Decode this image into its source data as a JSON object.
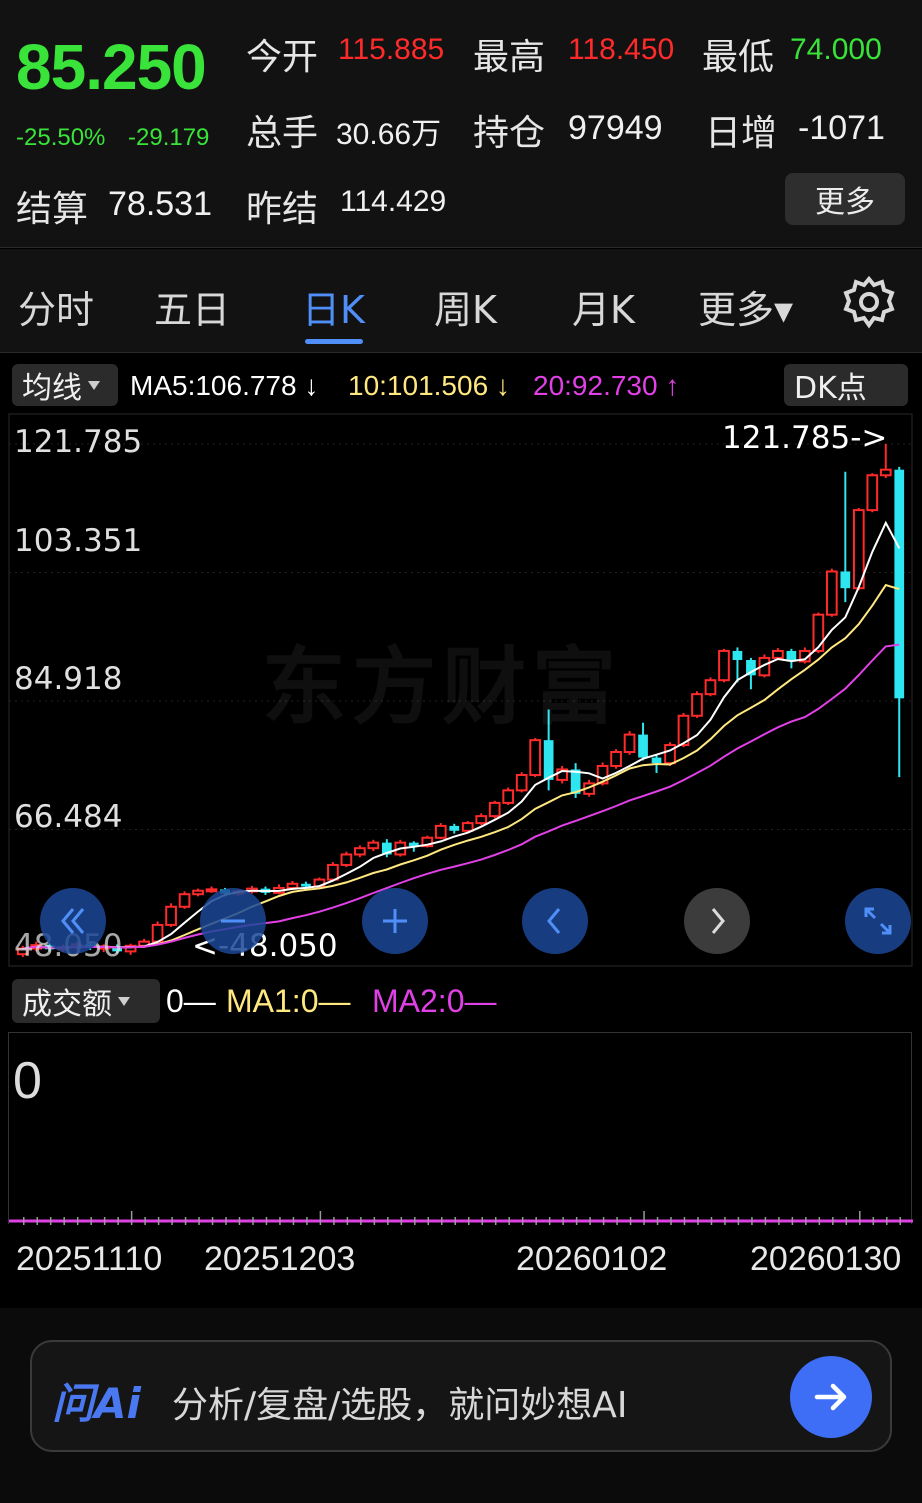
{
  "quote": {
    "price": "85.250",
    "change_pct": "-25.50%",
    "change_abs": "-29.179",
    "open_label": "今开",
    "open": "115.885",
    "high_label": "最高",
    "high": "118.450",
    "low_label": "最低",
    "low": "74.000",
    "volume_label": "总手",
    "volume": "30.66万",
    "oi_label": "持仓",
    "oi": "97949",
    "daily_label": "日增",
    "daily": "-1071",
    "settle_label": "结算",
    "settle": "78.531",
    "prev_settle_label": "昨结",
    "prev_settle": "114.429",
    "more_label": "更多"
  },
  "tabs": [
    {
      "label": "分时"
    },
    {
      "label": "五日"
    },
    {
      "label": "日K",
      "active": true
    },
    {
      "label": "周K"
    },
    {
      "label": "月K"
    },
    {
      "label": "更多▾"
    }
  ],
  "settings_icon": "gear-icon",
  "ma_row": {
    "selector_label": "均线",
    "ma5": "MA5:106.778 ↓",
    "ma10": "10:101.506 ↓",
    "ma20": "20:92.730 ↑",
    "dk_label": "DK点"
  },
  "colors": {
    "up": "#ff2a2a",
    "down": "#2ee6f0",
    "ma5": "#ffffff",
    "ma10": "#ffe880",
    "ma20": "#e040e6",
    "accent": "#4f8ff7",
    "green": "#39e33a"
  },
  "chart_data": {
    "type": "candlestick",
    "y_ticks": [
      "121.785",
      "103.351",
      "84.918",
      "66.484",
      "48.050"
    ],
    "ylim": [
      48.05,
      121.785
    ],
    "high_annotation": "121.785->",
    "low_annotation": "<-48.050",
    "watermark": "东方财富",
    "x_dates": [
      "20251110",
      "20251203",
      "20260102",
      "20260130"
    ],
    "candles": [
      [
        48.6,
        49.4,
        48.2,
        49.8
      ],
      [
        49.4,
        49.9,
        49.0,
        50.4
      ],
      [
        49.9,
        49.3,
        49.0,
        50.2
      ],
      [
        49.3,
        49.6,
        48.9,
        50.0
      ],
      [
        49.6,
        50.0,
        49.2,
        50.3
      ],
      [
        50.0,
        49.6,
        49.2,
        50.3
      ],
      [
        49.6,
        49.7,
        48.9,
        50.0
      ],
      [
        49.7,
        49.0,
        48.7,
        50.0
      ],
      [
        49.0,
        49.8,
        48.5,
        50.1
      ],
      [
        49.8,
        50.4,
        49.5,
        50.8
      ],
      [
        50.4,
        52.8,
        50.1,
        53.3
      ],
      [
        52.8,
        55.4,
        52.5,
        55.9
      ],
      [
        55.4,
        57.2,
        55.1,
        57.6
      ],
      [
        57.2,
        57.7,
        56.9,
        58.0
      ],
      [
        57.7,
        57.9,
        57.4,
        58.3
      ],
      [
        57.9,
        57.3,
        56.9,
        58.1
      ],
      [
        57.3,
        57.6,
        57.0,
        57.9
      ],
      [
        57.6,
        58.0,
        57.3,
        58.4
      ],
      [
        58.0,
        57.4,
        57.1,
        58.3
      ],
      [
        57.4,
        58.1,
        57.2,
        58.6
      ],
      [
        58.1,
        58.7,
        57.8,
        59.1
      ],
      [
        58.7,
        58.3,
        57.9,
        59.0
      ],
      [
        58.3,
        59.3,
        58.1,
        59.6
      ],
      [
        59.3,
        61.4,
        59.0,
        61.8
      ],
      [
        61.4,
        62.9,
        61.1,
        63.3
      ],
      [
        62.9,
        63.8,
        62.5,
        64.2
      ],
      [
        63.8,
        64.6,
        63.4,
        65.0
      ],
      [
        64.6,
        62.9,
        62.5,
        65.1
      ],
      [
        62.9,
        64.6,
        62.6,
        65.0
      ],
      [
        64.6,
        64.1,
        63.3,
        64.8
      ],
      [
        64.1,
        65.3,
        63.9,
        65.6
      ],
      [
        65.3,
        67.0,
        65.1,
        67.4
      ],
      [
        67.0,
        66.3,
        65.9,
        67.3
      ],
      [
        66.3,
        67.4,
        66.0,
        67.7
      ],
      [
        67.4,
        68.4,
        67.1,
        68.8
      ],
      [
        68.4,
        70.3,
        68.1,
        70.6
      ],
      [
        70.3,
        72.1,
        70.0,
        72.5
      ],
      [
        72.1,
        74.3,
        71.8,
        74.7
      ],
      [
        74.3,
        79.3,
        74.0,
        79.6
      ],
      [
        79.3,
        73.6,
        72.1,
        83.7
      ],
      [
        73.6,
        75.1,
        73.1,
        75.6
      ],
      [
        75.1,
        71.6,
        71.0,
        76.0
      ],
      [
        71.6,
        73.1,
        71.2,
        73.6
      ],
      [
        73.1,
        75.6,
        72.8,
        76.1
      ],
      [
        75.6,
        77.6,
        75.2,
        78.0
      ],
      [
        77.6,
        80.1,
        77.2,
        80.6
      ],
      [
        80.1,
        76.8,
        76.4,
        81.8
      ],
      [
        76.8,
        76.0,
        74.6,
        77.3
      ],
      [
        76.0,
        78.6,
        75.6,
        79.0
      ],
      [
        78.6,
        82.8,
        78.3,
        83.2
      ],
      [
        82.8,
        85.9,
        82.5,
        86.3
      ],
      [
        85.9,
        87.9,
        85.6,
        88.3
      ],
      [
        87.9,
        92.1,
        87.6,
        92.4
      ],
      [
        92.1,
        90.8,
        87.6,
        92.6
      ],
      [
        90.8,
        88.6,
        86.6,
        91.1
      ],
      [
        88.6,
        91.1,
        88.3,
        91.6
      ],
      [
        91.1,
        92.1,
        90.8,
        92.5
      ],
      [
        92.1,
        90.6,
        89.6,
        92.4
      ],
      [
        90.6,
        92.1,
        90.3,
        92.6
      ],
      [
        92.1,
        97.3,
        91.8,
        97.6
      ],
      [
        97.3,
        103.5,
        97.0,
        103.9
      ],
      [
        103.5,
        101.1,
        99.1,
        117.8
      ],
      [
        101.1,
        112.3,
        100.8,
        112.6
      ],
      [
        112.3,
        117.3,
        112.0,
        117.6
      ],
      [
        117.3,
        118.1,
        116.9,
        121.8
      ],
      [
        118.1,
        85.3,
        74.0,
        118.5
      ]
    ]
  },
  "nav_buttons": [
    {
      "name": "rewind-button",
      "icon": "double-left-icon",
      "style": "blue"
    },
    {
      "name": "zoom-out-button",
      "icon": "minus-icon",
      "style": "blue"
    },
    {
      "name": "zoom-in-button",
      "icon": "plus-icon",
      "style": "blue"
    },
    {
      "name": "prev-button",
      "icon": "chevron-left-icon",
      "style": "blue"
    },
    {
      "name": "next-button",
      "icon": "chevron-right-icon",
      "style": "grey"
    },
    {
      "name": "fullscreen-button",
      "icon": "expand-icon",
      "style": "blue"
    }
  ],
  "volume": {
    "selector_label": "成交额",
    "v0": "0—",
    "ma1": "MA1:0—",
    "ma2": "MA2:0—",
    "zero": "0"
  },
  "ai": {
    "logo": "问Ai",
    "placeholder": "分析/复盘/选股，就问妙想AI"
  }
}
